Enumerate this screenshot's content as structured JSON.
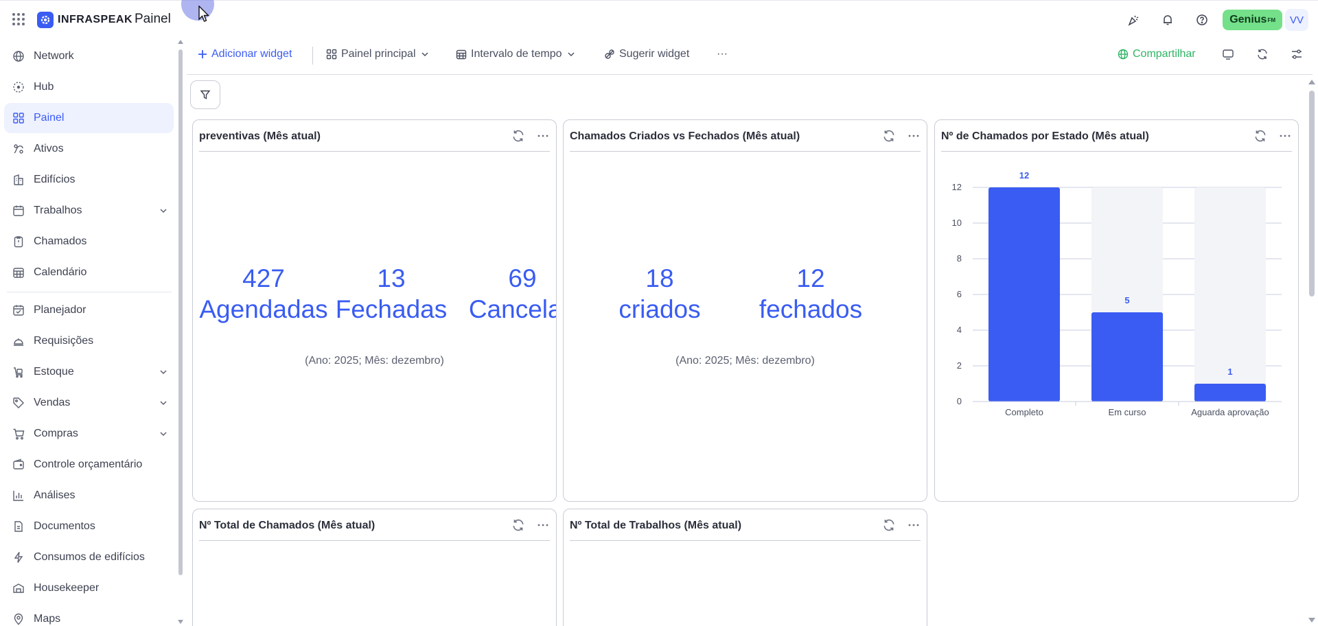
{
  "app": {
    "logo_text": "INFRASPEAK",
    "page_title": "Painel"
  },
  "topbar": {
    "genius_label": "Genius",
    "genius_sup": "FM",
    "avatar_initials": "VV"
  },
  "sidebar": {
    "items": [
      {
        "label": "Network",
        "icon": "globe-icon"
      },
      {
        "label": "Hub",
        "icon": "hub-icon"
      },
      {
        "label": "Painel",
        "icon": "dashboard-icon",
        "active": true
      },
      {
        "label": "Ativos",
        "icon": "assets-icon"
      },
      {
        "label": "Edifícios",
        "icon": "building-icon"
      },
      {
        "label": "Trabalhos",
        "icon": "calendar-icon",
        "expandable": true
      },
      {
        "label": "Chamados",
        "icon": "clipboard-icon"
      },
      {
        "label": "Calendário",
        "icon": "calendar-grid-icon"
      },
      {
        "label": "Planejador",
        "icon": "planner-icon"
      },
      {
        "label": "Requisições",
        "icon": "bell-service-icon"
      },
      {
        "label": "Estoque",
        "icon": "stock-icon",
        "expandable": true
      },
      {
        "label": "Vendas",
        "icon": "tag-icon",
        "expandable": true
      },
      {
        "label": "Compras",
        "icon": "cart-icon",
        "expandable": true
      },
      {
        "label": "Controle orçamentário",
        "icon": "wallet-icon"
      },
      {
        "label": "Análises",
        "icon": "bar-chart-icon"
      },
      {
        "label": "Documentos",
        "icon": "document-icon"
      },
      {
        "label": "Consumos de edifícios",
        "icon": "lightning-icon"
      },
      {
        "label": "Housekeeper",
        "icon": "housekeeper-icon"
      },
      {
        "label": "Maps",
        "icon": "map-pin-icon"
      }
    ]
  },
  "toolbar": {
    "add_widget": "Adicionar widget",
    "main_panel": "Painel principal",
    "time_interval": "Intervalo de tempo",
    "suggest_widget": "Sugerir widget",
    "more": "···",
    "share": "Compartilhar"
  },
  "widgets": {
    "preventivas": {
      "title": "preventivas (Mês atual)",
      "kpis": [
        {
          "value": "427",
          "label": "Agendadas"
        },
        {
          "value": "13",
          "label": "Fechadas"
        },
        {
          "value": "69",
          "label": "Cancelad"
        }
      ],
      "subtitle": "(Ano: 2025; Mês: dezembro)"
    },
    "criados_fechados": {
      "title": "Chamados Criados vs Fechados (Mês atual)",
      "kpis": [
        {
          "value": "18",
          "label": "criados"
        },
        {
          "value": "12",
          "label": "fechados"
        }
      ],
      "subtitle": "(Ano: 2025; Mês: dezembro)"
    },
    "por_estado": {
      "title": "Nº de Chamados por Estado (Mês atual)"
    },
    "total_chamados": {
      "title": "Nº Total de Chamados (Mês atual)"
    },
    "total_trabalhos": {
      "title": "Nº Total de Trabalhos (Mês atual)"
    }
  },
  "chart_data": {
    "type": "bar",
    "title": "Nº de Chamados por Estado (Mês atual)",
    "categories": [
      "Completo",
      "Em curso",
      "Aguarda aprovação"
    ],
    "values": [
      12,
      5,
      1
    ],
    "data_labels": [
      "12",
      "5",
      "1"
    ],
    "ylim": [
      0,
      12
    ],
    "yticks": [
      "0",
      "2",
      "4",
      "6",
      "8",
      "10",
      "12"
    ],
    "xlabel": "",
    "ylabel": "",
    "grid": true,
    "bar_color": "#3a5cf2",
    "track_color": "#f3f4f7"
  },
  "colors": {
    "accent": "#3a5cf2",
    "share": "#2fb465",
    "genius": "#74e08a"
  }
}
